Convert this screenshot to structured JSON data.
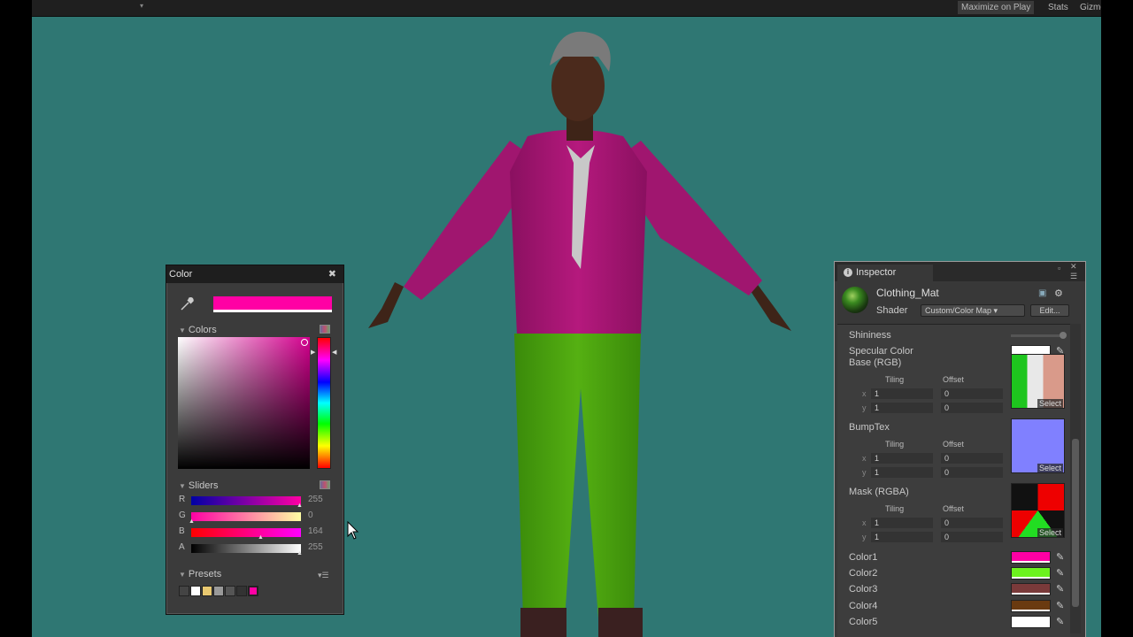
{
  "toolbar": {
    "maximize_on_play": "Maximize on Play",
    "stats": "Stats",
    "gizmos": "Gizmos",
    "dropdown_icon": "chevron-down-icon"
  },
  "viewport": {
    "background_color": "#2f7773",
    "character_colors": {
      "shirt": "#b5197d",
      "pants": "#4fa80e",
      "skin": "#4b2a1c",
      "hair": "#7a7a7a",
      "tie": "#c8c8c8"
    }
  },
  "color_picker": {
    "title": "Color",
    "close_icon": "close-icon",
    "current_color": "#ff00a4",
    "colors_section": "Colors",
    "sliders_section": "Sliders",
    "presets_section": "Presets",
    "channels": [
      {
        "label": "R",
        "value": "255"
      },
      {
        "label": "G",
        "value": "0"
      },
      {
        "label": "B",
        "value": "164"
      },
      {
        "label": "A",
        "value": "255"
      }
    ],
    "presets": [
      "#444444",
      "#ffffff",
      "#e8c870",
      "#999999",
      "#555555",
      "#333333",
      "#ff00a4"
    ]
  },
  "inspector": {
    "tab_label": "Inspector",
    "material_name": "Clothing_Mat",
    "shader_label": "Shader",
    "shader_value": "Custom/Color Map",
    "edit_label": "Edit...",
    "shininess_label": "Shininess",
    "specular_label": "Specular Color",
    "specular_color": "#ffffff",
    "tiling_label": "Tiling",
    "offset_label": "Offset",
    "x_label": "x",
    "y_label": "y",
    "select_label": "Select",
    "textures": [
      {
        "label": "Base (RGB)",
        "tiling_x": "1",
        "tiling_y": "1",
        "offset_x": "0",
        "offset_y": "0"
      },
      {
        "label": "BumpTex",
        "tiling_x": "1",
        "tiling_y": "1",
        "offset_x": "0",
        "offset_y": "0"
      },
      {
        "label": "Mask (RGBA)",
        "tiling_x": "1",
        "tiling_y": "1",
        "offset_x": "0",
        "offset_y": "0"
      }
    ],
    "color_props": [
      {
        "label": "Color1",
        "color": "#ff00a4"
      },
      {
        "label": "Color2",
        "color": "#6cf21e"
      },
      {
        "label": "Color3",
        "color": "#7a3a3a"
      },
      {
        "label": "Color4",
        "color": "#6a3a10"
      },
      {
        "label": "Color5",
        "color": "#ffffff"
      }
    ]
  }
}
